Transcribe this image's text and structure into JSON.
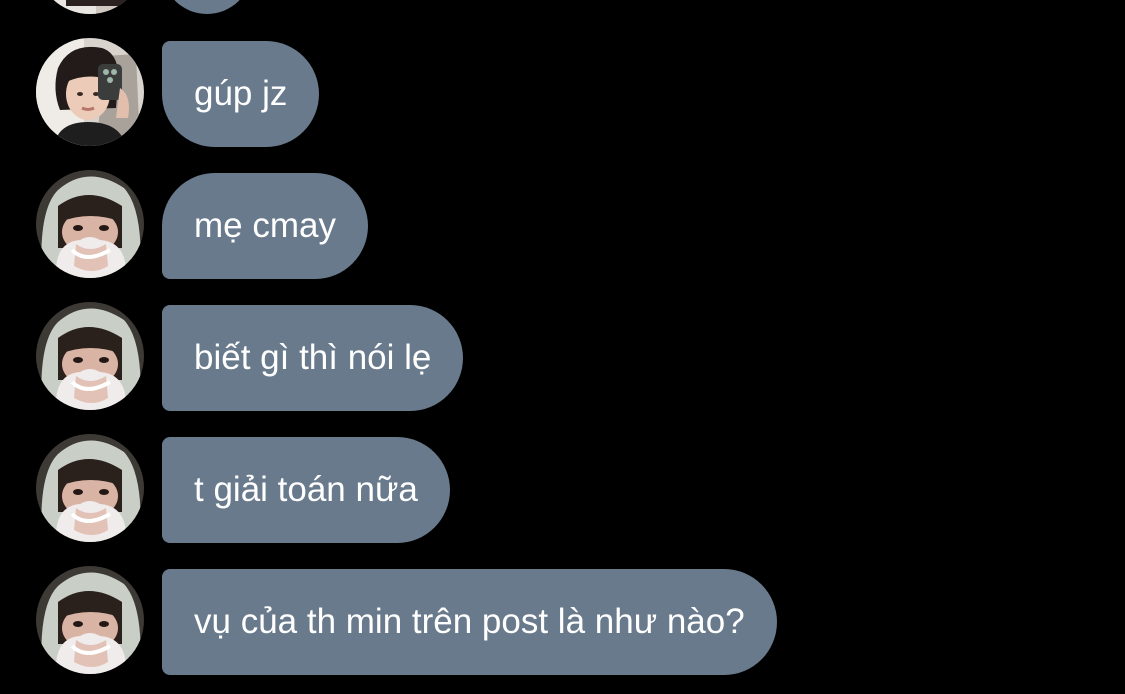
{
  "chat": {
    "messages": [
      {
        "sender": "user-a",
        "text": "gúp jz",
        "avatar_icon": "profile-photo-girl-mirror-selfie"
      },
      {
        "sender": "user-b",
        "text": "mẹ cmay",
        "avatar_icon": "profile-photo-hooded-person"
      },
      {
        "sender": "user-b",
        "text": "biết gì thì nói lẹ",
        "avatar_icon": "profile-photo-hooded-person"
      },
      {
        "sender": "user-b",
        "text": "t giải toán nữa",
        "avatar_icon": "profile-photo-hooded-person"
      },
      {
        "sender": "user-b",
        "text": "vụ của th min trên post là như nào?",
        "avatar_icon": "profile-photo-hooded-person"
      }
    ]
  },
  "colors": {
    "background": "#000000",
    "bubble": "#687a8c",
    "text": "#ffffff"
  }
}
